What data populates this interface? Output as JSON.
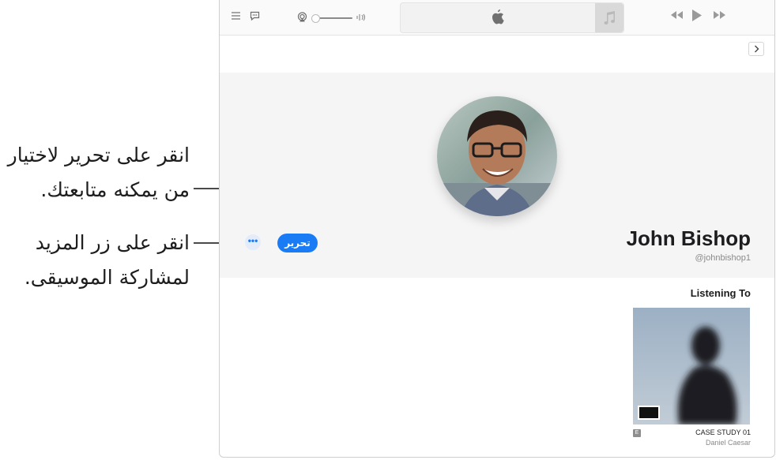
{
  "callouts": {
    "edit_line1": "انقر على تحرير لاختيار",
    "edit_line2": "من يمكنه متابعتك.",
    "more_line1": "انقر على زر المزيد",
    "more_line2": "لمشاركة الموسيقى."
  },
  "profile": {
    "name": "John Bishop",
    "handle": "@johnbishop1",
    "edit_label": "تحرير",
    "more_label": "•••"
  },
  "listening": {
    "title": "Listening To",
    "album_title": "CASE STUDY 01",
    "artist": "Daniel Caesar",
    "explicit_badge": "E"
  },
  "toolbar": {
    "icons": [
      "list-icon",
      "lyrics-icon",
      "airplay-icon",
      "volume-slider",
      "apple-logo",
      "music-note-icon",
      "rewind-icon",
      "play-icon",
      "fast-forward-icon"
    ]
  }
}
